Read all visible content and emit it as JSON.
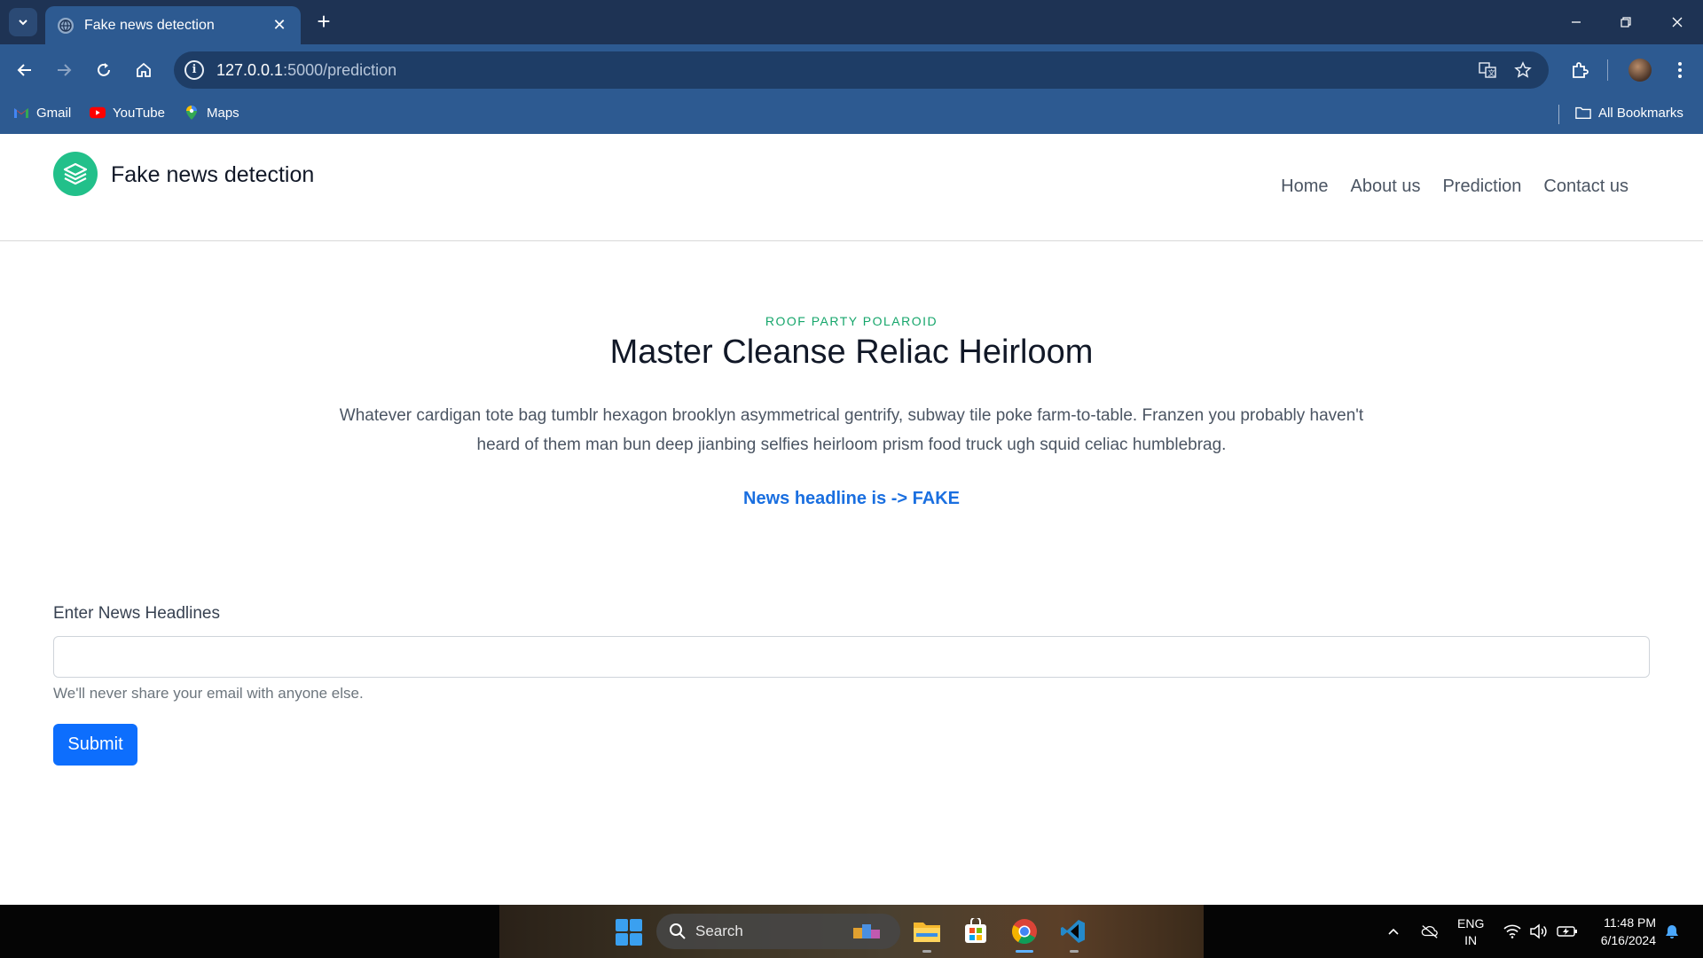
{
  "browser": {
    "tab_title": "Fake news detection",
    "url_host": "127.0.0.1",
    "url_path": ":5000/prediction",
    "bookmarks": [
      {
        "label": "Gmail",
        "icon": "gmail-icon"
      },
      {
        "label": "YouTube",
        "icon": "youtube-icon"
      },
      {
        "label": "Maps",
        "icon": "maps-icon"
      }
    ],
    "all_bookmarks_label": "All Bookmarks"
  },
  "site": {
    "brand": "Fake news detection",
    "nav": [
      "Home",
      "About us",
      "Prediction",
      "Contact us"
    ]
  },
  "hero": {
    "eyebrow": "ROOF PARTY POLAROID",
    "headline": "Master Cleanse Reliac Heirloom",
    "lead": "Whatever cardigan tote bag tumblr hexagon brooklyn asymmetrical gentrify, subway tile poke farm-to-table. Franzen you probably haven't heard of them man bun deep jianbing selfies heirloom prism food truck ugh squid celiac humblebrag.",
    "result": "News headline is -> FAKE"
  },
  "form": {
    "label": "Enter News Headlines",
    "value": "",
    "placeholder": "",
    "help": "We'll never share your email with anyone else.",
    "submit_label": "Submit"
  },
  "taskbar": {
    "search_label": "Search",
    "lang_top": "ENG",
    "lang_bottom": "IN",
    "time": "11:48 PM",
    "date": "6/16/2024"
  },
  "colors": {
    "accent_green": "#22c08a",
    "result_blue": "#1a6fe0",
    "button_blue": "#0d6efd",
    "chrome_blue": "#2d5a91"
  }
}
